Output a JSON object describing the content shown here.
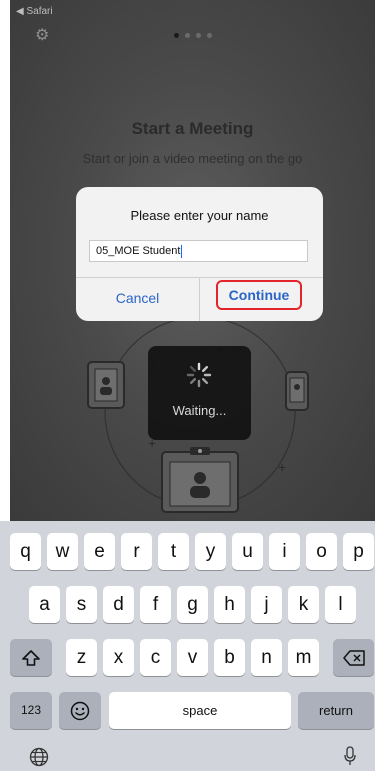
{
  "status_bar": {
    "back_label": "◀ Safari"
  },
  "onboarding": {
    "title": "Start a Meeting",
    "subtitle": "Start or join a video meeting on the go"
  },
  "waiting": {
    "label": "Waiting..."
  },
  "dialog": {
    "title": "Please enter your name",
    "name_value": "05_MOE Student",
    "cancel_label": "Cancel",
    "continue_label": "Continue"
  },
  "keyboard": {
    "row1": [
      "q",
      "w",
      "e",
      "r",
      "t",
      "y",
      "u",
      "i",
      "o",
      "p"
    ],
    "row2": [
      "a",
      "s",
      "d",
      "f",
      "g",
      "h",
      "j",
      "k",
      "l"
    ],
    "row3": [
      "z",
      "x",
      "c",
      "v",
      "b",
      "n",
      "m"
    ],
    "shift_icon": "shift-arrow-icon",
    "backspace_icon": "backspace-icon",
    "numbers_label": "123",
    "emoji_icon": "emoji-icon",
    "space_label": "space",
    "return_label": "return",
    "globe_icon": "globe-icon",
    "mic_icon": "microphone-icon"
  },
  "colors": {
    "link_blue": "#2b66c7",
    "highlight_red": "#e4242b"
  }
}
